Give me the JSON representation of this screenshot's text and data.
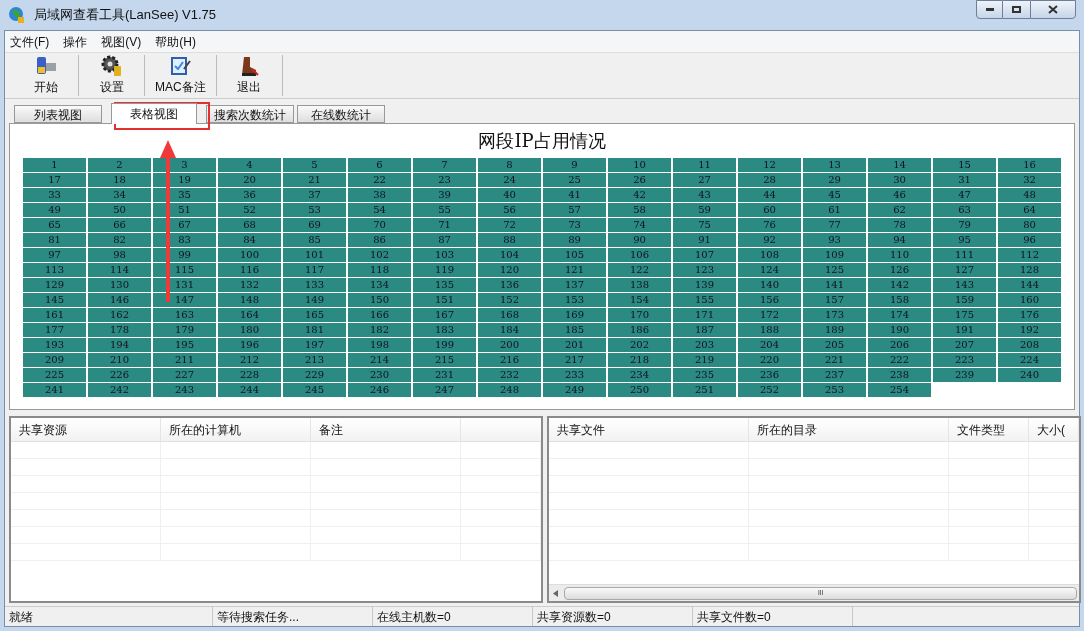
{
  "window": {
    "title": "局域网查看工具(LanSee) V1.75"
  },
  "menu": [
    "文件(F)",
    "操作",
    "视图(V)",
    "帮助(H)"
  ],
  "toolbar": [
    {
      "label": "开始",
      "kind": "start"
    },
    {
      "label": "设置",
      "kind": "settings"
    },
    {
      "label": "MAC备注",
      "kind": "note"
    },
    {
      "label": "退出",
      "kind": "exit"
    }
  ],
  "tabs": [
    {
      "label": "列表视图",
      "selected": false
    },
    {
      "label": "表格视图",
      "selected": true
    },
    {
      "label": "搜索次数统计",
      "selected": false
    },
    {
      "label": "在线数统计",
      "selected": false
    }
  ],
  "ip_grid": {
    "title": "网段IP占用情况",
    "cells": [
      "1",
      "2",
      "3",
      "4",
      "5",
      "6",
      "7",
      "8",
      "9",
      "10",
      "11",
      "12",
      "13",
      "14",
      "15",
      "16",
      "17",
      "18",
      "19",
      "20",
      "21",
      "22",
      "23",
      "24",
      "25",
      "26",
      "27",
      "28",
      "29",
      "30",
      "31",
      "32",
      "33",
      "34",
      "35",
      "36",
      "37",
      "38",
      "39",
      "40",
      "41",
      "42",
      "43",
      "44",
      "45",
      "46",
      "47",
      "48",
      "49",
      "50",
      "51",
      "52",
      "53",
      "54",
      "55",
      "56",
      "57",
      "58",
      "59",
      "60",
      "61",
      "62",
      "63",
      "64",
      "65",
      "66",
      "67",
      "68",
      "69",
      "70",
      "71",
      "72",
      "73",
      "74",
      "75",
      "76",
      "77",
      "78",
      "79",
      "80",
      "81",
      "82",
      "83",
      "84",
      "85",
      "86",
      "87",
      "88",
      "89",
      "90",
      "91",
      "92",
      "93",
      "94",
      "95",
      "96",
      "97",
      "98",
      "99",
      "100",
      "101",
      "102",
      "103",
      "104",
      "105",
      "106",
      "107",
      "108",
      "109",
      "110",
      "111",
      "112",
      "113",
      "114",
      "115",
      "116",
      "117",
      "118",
      "119",
      "120",
      "121",
      "122",
      "123",
      "124",
      "125",
      "126",
      "127",
      "128",
      "129",
      "130",
      "131",
      "132",
      "133",
      "134",
      "135",
      "136",
      "137",
      "138",
      "139",
      "140",
      "141",
      "142",
      "143",
      "144",
      "145",
      "146",
      "147",
      "148",
      "149",
      "150",
      "151",
      "152",
      "153",
      "154",
      "155",
      "156",
      "157",
      "158",
      "159",
      "160",
      "161",
      "162",
      "163",
      "164",
      "165",
      "166",
      "167",
      "168",
      "169",
      "170",
      "171",
      "172",
      "173",
      "174",
      "175",
      "176",
      "177",
      "178",
      "179",
      "180",
      "181",
      "182",
      "183",
      "184",
      "185",
      "186",
      "187",
      "188",
      "189",
      "190",
      "191",
      "192",
      "193",
      "194",
      "195",
      "196",
      "197",
      "198",
      "199",
      "200",
      "201",
      "202",
      "203",
      "204",
      "205",
      "206",
      "207",
      "208",
      "209",
      "210",
      "211",
      "212",
      "213",
      "214",
      "215",
      "216",
      "217",
      "218",
      "219",
      "220",
      "221",
      "222",
      "223",
      "224",
      "225",
      "226",
      "227",
      "228",
      "229",
      "230",
      "231",
      "232",
      "233",
      "234",
      "235",
      "236",
      "237",
      "238",
      "239",
      "240",
      "241",
      "242",
      "243",
      "244",
      "245",
      "246",
      "247",
      "248",
      "249",
      "250",
      "251",
      "252",
      "253",
      "254"
    ]
  },
  "shares_table": {
    "columns": [
      "共享资源",
      "所在的计算机",
      "备注"
    ]
  },
  "files_table": {
    "columns": [
      "共享文件",
      "所在的目录",
      "文件类型",
      "大小("
    ],
    "scrollbar_grip": "III"
  },
  "status_bar": [
    "就绪",
    "等待搜索任务...",
    "在线主机数=0",
    "共享资源数=0",
    "共享文件数=0"
  ]
}
